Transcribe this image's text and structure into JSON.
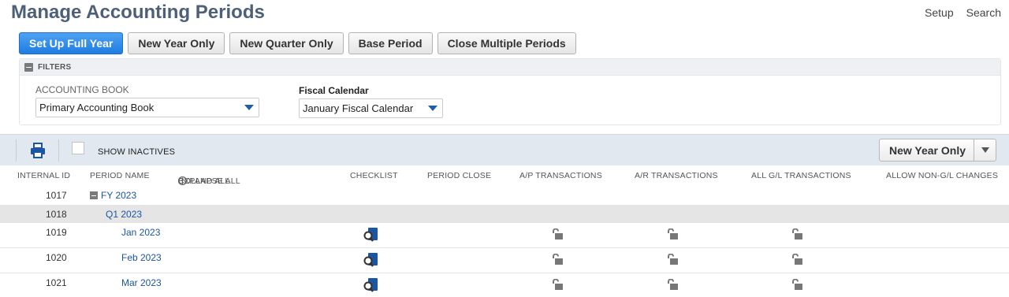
{
  "page": {
    "title": "Manage Accounting Periods",
    "links": [
      "Setup",
      "Search"
    ]
  },
  "actions": {
    "set_up_full_year": "Set Up Full Year",
    "new_year_only": "New Year Only",
    "new_quarter_only": "New Quarter Only",
    "base_period": "Base Period",
    "close_multiple_periods": "Close Multiple Periods"
  },
  "filters": {
    "header": "FILTERS",
    "accounting_book": {
      "label": "ACCOUNTING BOOK",
      "value": "Primary Accounting Book"
    },
    "fiscal_calendar": {
      "label": "Fiscal Calendar",
      "value": "January Fiscal Calendar"
    }
  },
  "toolbar": {
    "show_inactives": "SHOW INACTIVES",
    "show_inactives_checked": false,
    "new_year_only": "New Year Only"
  },
  "columns": {
    "internal_id": "INTERNAL ID",
    "period_name": "PERIOD NAME",
    "expand_all": "EXPAND ALL",
    "divider": "|",
    "collapse_all": "COLLAPSE ALL",
    "checklist": "CHECKLIST",
    "period_close": "PERIOD CLOSE",
    "ap": "A/P TRANSACTIONS",
    "ar": "A/R TRANSACTIONS",
    "gl": "ALL G/L TRANSACTIONS",
    "non_gl": "ALLOW NON-G/L CHANGES"
  },
  "rows": [
    {
      "id": "1017",
      "name": "FY 2023",
      "level": "year"
    },
    {
      "id": "1018",
      "name": "Q1 2023",
      "level": "quarter"
    },
    {
      "id": "1019",
      "name": "Jan 2023",
      "level": "month",
      "checklist_icon": "checklist-search-icon",
      "lock_icon": "unlocked-icon"
    },
    {
      "id": "1020",
      "name": "Feb 2023",
      "level": "month",
      "checklist_icon": "checklist-search-icon",
      "lock_icon": "unlocked-icon"
    },
    {
      "id": "1021",
      "name": "Mar 2023",
      "level": "month",
      "checklist_icon": "checklist-search-icon",
      "lock_icon": "unlocked-icon"
    }
  ],
  "colors": {
    "title": "#4d5f79",
    "primary_button": "#2a86e8",
    "link": "#1a56a3",
    "toolbar_bg": "#e2e8f0"
  }
}
